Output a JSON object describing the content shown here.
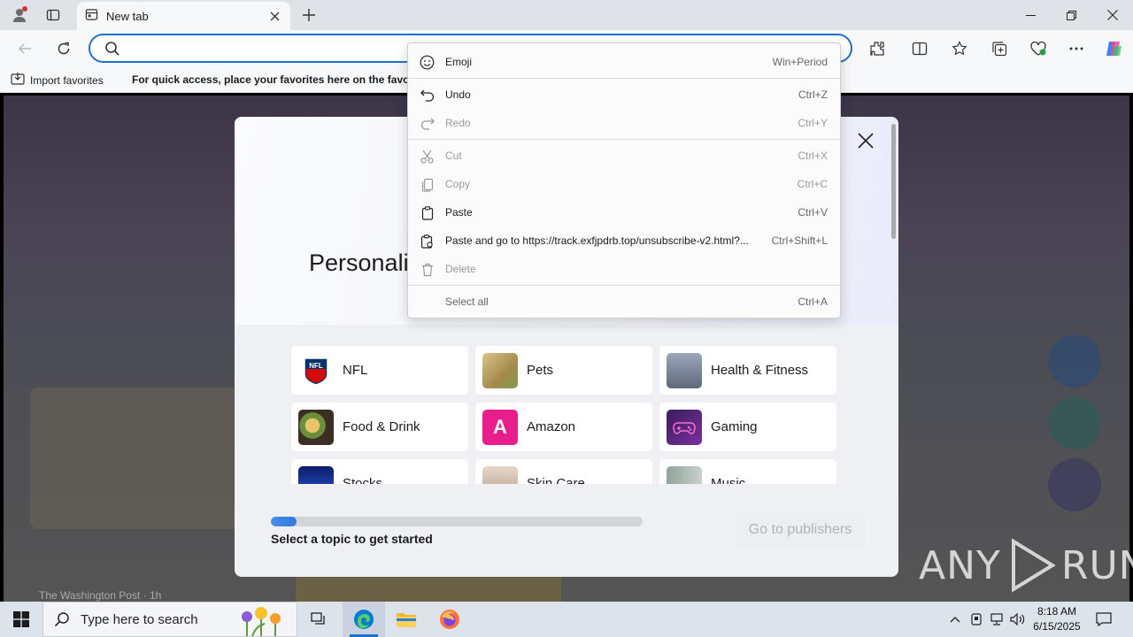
{
  "browser": {
    "tab_title": "New tab",
    "address_value": ""
  },
  "favorites_bar": {
    "import_label": "Import favorites",
    "message": "For quick access, place your favorites here on the favorite"
  },
  "context_menu": {
    "items": [
      {
        "label": "Emoji",
        "shortcut": "Win+Period",
        "enabled": true,
        "icon": "emoji-icon"
      },
      {
        "label": "Undo",
        "shortcut": "Ctrl+Z",
        "enabled": true,
        "icon": "undo-icon"
      },
      {
        "label": "Redo",
        "shortcut": "Ctrl+Y",
        "enabled": false,
        "icon": "redo-icon"
      },
      {
        "label": "Cut",
        "shortcut": "Ctrl+X",
        "enabled": false,
        "icon": "cut-icon"
      },
      {
        "label": "Copy",
        "shortcut": "Ctrl+C",
        "enabled": false,
        "icon": "copy-icon"
      },
      {
        "label": "Paste",
        "shortcut": "Ctrl+V",
        "enabled": true,
        "icon": "paste-icon"
      },
      {
        "label": "Paste and go to https://track.exfjpdrb.top/unsubscribe-v2.html?...",
        "shortcut": "Ctrl+Shift+L",
        "enabled": true,
        "icon": "paste-go-icon"
      },
      {
        "label": "Delete",
        "shortcut": "",
        "enabled": false,
        "icon": "delete-icon"
      },
      {
        "label": "Select all",
        "shortcut": "Ctrl+A",
        "enabled": true,
        "icon": ""
      }
    ]
  },
  "dialog": {
    "title": "Personali",
    "topics": [
      {
        "label": "NFL",
        "thumb": "nfl-logo"
      },
      {
        "label": "Pets",
        "thumb": "pets-image"
      },
      {
        "label": "Health & Fitness",
        "thumb": "fitness-image"
      },
      {
        "label": "Food & Drink",
        "thumb": "food-image"
      },
      {
        "label": "Amazon",
        "thumb": "amazon-logo",
        "thumb_text": "A"
      },
      {
        "label": "Gaming",
        "thumb": "gaming-image"
      },
      {
        "label": "Stocks",
        "thumb": "stocks-image"
      },
      {
        "label": "Skin Care",
        "thumb": "skincare-image"
      },
      {
        "label": "Music",
        "thumb": "music-image"
      }
    ],
    "progress_fraction": 0.07,
    "prompt": "Select a topic to get started",
    "publishers_button": "Go to publishers"
  },
  "page": {
    "source_text": "The Washington Post · 1h"
  },
  "watermark": "ANY RUN",
  "taskbar": {
    "search_placeholder": "Type here to search",
    "time": "8:18 AM",
    "date": "6/15/2025"
  },
  "colors": {
    "accent": "#1f6fd1",
    "amazon": "#e91e8c",
    "gaming": "#5b2a86"
  }
}
